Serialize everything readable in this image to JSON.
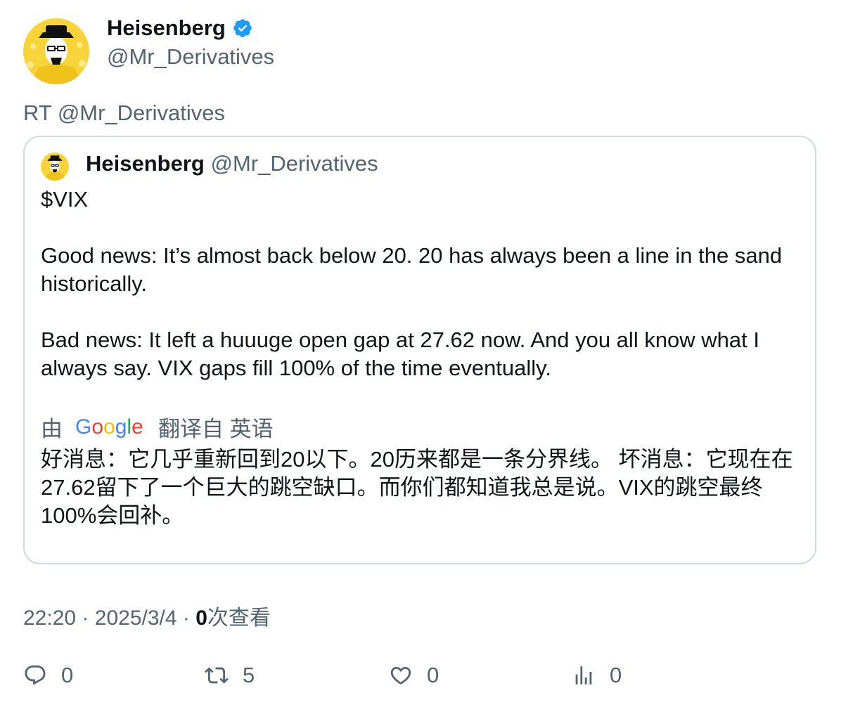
{
  "tweet": {
    "author_name": "Heisenberg",
    "author_handle": "@Mr_Derivatives",
    "verified": true,
    "rt_line": "RT @Mr_Derivatives",
    "accent_color": "#1d9bf0",
    "avatar_icon": "heisenberg-avatar-icon"
  },
  "quote": {
    "author_name": "Heisenberg",
    "author_handle": "@Mr_Derivatives",
    "line1": "$VIX",
    "line2": "Good news: It’s almost back below 20. 20 has always been a line in the sand historically.",
    "line3": "Bad news: It left a huuuge open gap at 27.62 now. And you all know what I always say. VIX gaps fill 100% of the time eventually.",
    "translate_prefix": "由",
    "translate_brand": "Google",
    "translate_suffix": "翻译自 英语",
    "translated_text": "好消息：它几乎重新回到20以下。20历来都是一条分界线。 坏消息：它现在在27.62留下了一个巨大的跳空缺口。而你们都知道我总是说。VIX的跳空最终100%会回补。"
  },
  "meta": {
    "time": "22:20",
    "separator": "·",
    "date": "2025/3/4",
    "views_count": "0",
    "views_label": "次查看"
  },
  "actions": {
    "reply_count": "0",
    "retweet_count": "5",
    "like_count": "0",
    "views_count": "0"
  }
}
